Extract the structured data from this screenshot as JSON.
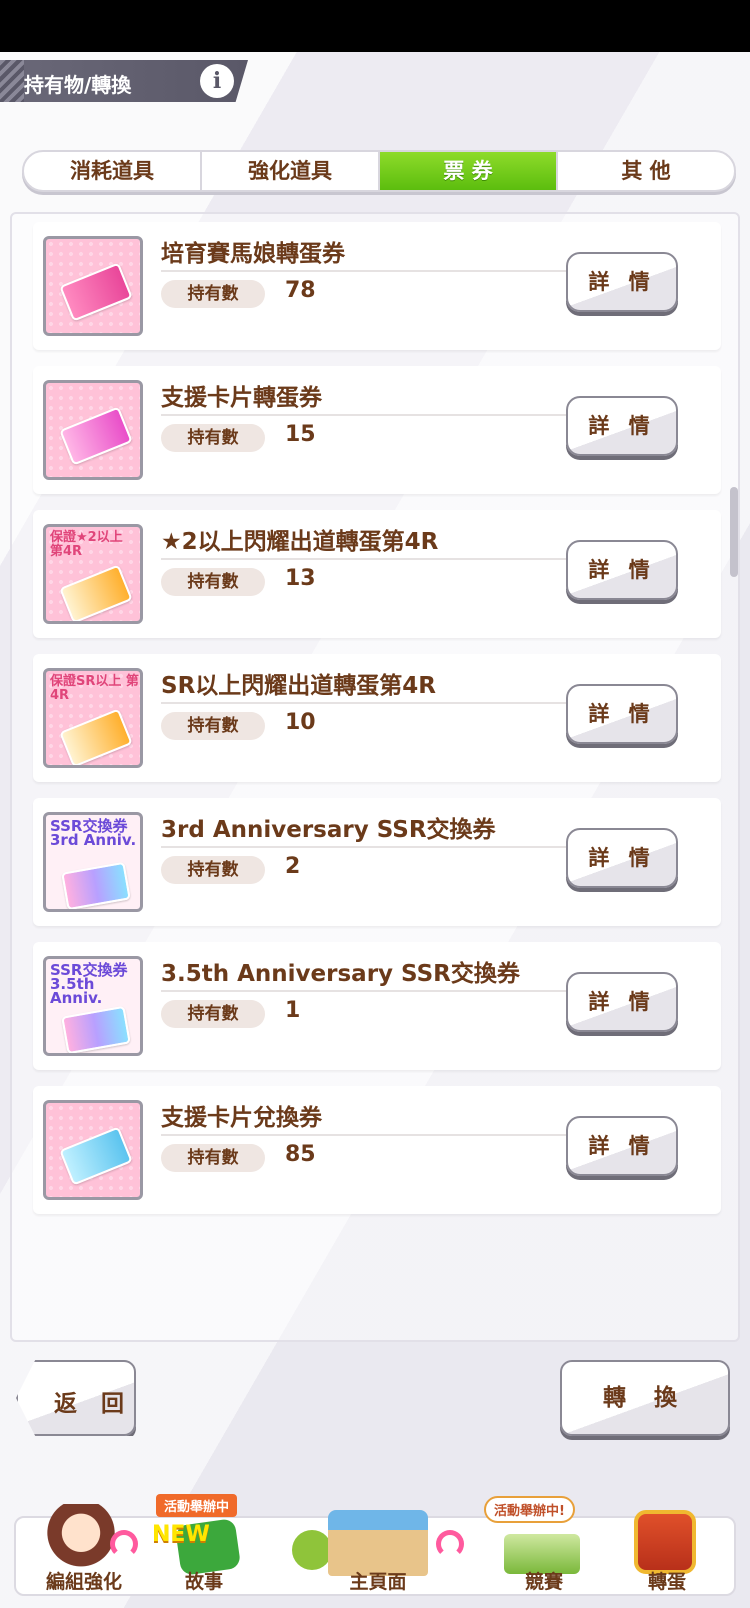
{
  "header": {
    "title": "持有物/轉換",
    "info_icon": "info-icon"
  },
  "tabs": [
    {
      "label": "消耗道具",
      "active": false
    },
    {
      "label": "強化道具",
      "active": false
    },
    {
      "label": "票 券",
      "active": true
    },
    {
      "label": "其 他",
      "active": false
    }
  ],
  "items": [
    {
      "name": "培育賽馬娘轉蛋券",
      "count_label": "持有數",
      "count": "78",
      "detail_label": "詳 情",
      "icon": "ticket-pink-icon"
    },
    {
      "name": "支援卡片轉蛋券",
      "count_label": "持有數",
      "count": "15",
      "detail_label": "詳 情",
      "icon": "ticket-pink-icon"
    },
    {
      "name": "★2以上閃耀出道轉蛋第4R",
      "count_label": "持有數",
      "count": "13",
      "detail_label": "詳 情",
      "icon": "ticket-guarantee-icon",
      "tag": "保證★2以上 第4R"
    },
    {
      "name": "SR以上閃耀出道轉蛋第4R",
      "count_label": "持有數",
      "count": "10",
      "detail_label": "詳 情",
      "icon": "ticket-guarantee-icon",
      "tag": "保證SR以上 第4R"
    },
    {
      "name": "3rd Anniversary SSR交換券",
      "count_label": "持有數",
      "count": "2",
      "detail_label": "詳 情",
      "icon": "ticket-ssr-icon",
      "tag": "SSR交換券 3rd Anniv."
    },
    {
      "name": "3.5th Anniversary SSR交換券",
      "count_label": "持有數",
      "count": "1",
      "detail_label": "詳 情",
      "icon": "ticket-ssr-icon",
      "tag": "SSR交換券 3.5th Anniv."
    },
    {
      "name": "支援卡片兌換券",
      "count_label": "持有數",
      "count": "85",
      "detail_label": "詳 情",
      "icon": "ticket-blue-icon"
    }
  ],
  "footer": {
    "back_label": "返 回",
    "convert_label": "轉 換"
  },
  "nav": [
    {
      "label": "編組強化"
    },
    {
      "label": "故事",
      "badge": "活動舉辦中",
      "new_badge": "NEW"
    },
    {
      "label": "主頁面"
    },
    {
      "label": "競賽",
      "badge": "活動舉辦中!"
    },
    {
      "label": "轉蛋"
    }
  ],
  "colors": {
    "active_tab": "#5cbd0e",
    "text_brown": "#6b3a1a",
    "accent_pink": "#ffc2d8"
  }
}
